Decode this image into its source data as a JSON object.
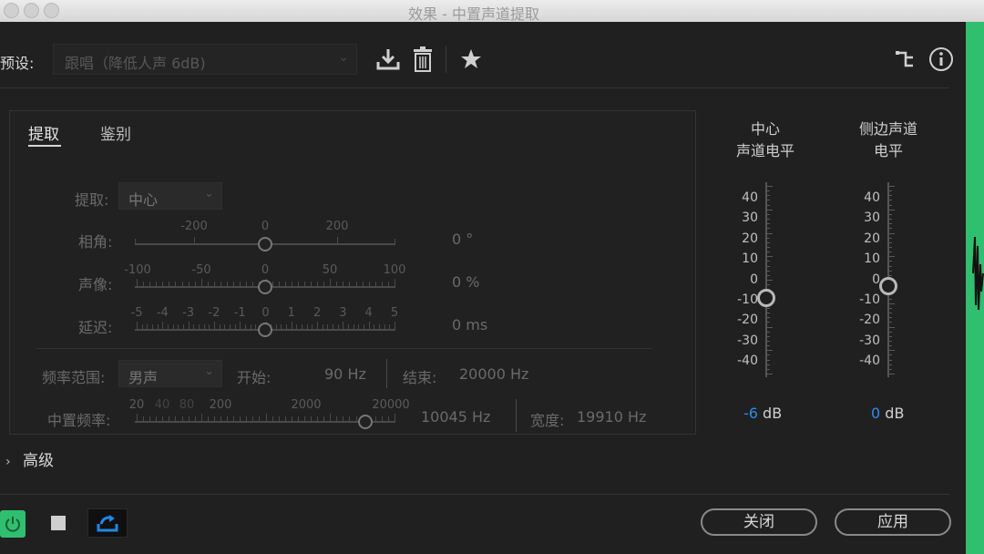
{
  "window": {
    "title": "效果 - 中置声道提取"
  },
  "header": {
    "preset_label": "预设:",
    "preset_value": "跟唱（降低人声 6dB)",
    "icons": [
      "download-icon",
      "trash-icon",
      "star-icon",
      "routing-icon",
      "info-icon"
    ]
  },
  "tabs": [
    {
      "label": "提取",
      "active": true
    },
    {
      "label": "鉴别",
      "active": false
    }
  ],
  "controls": {
    "extract": {
      "label": "提取:",
      "value": "中心"
    },
    "phase": {
      "label": "相角:",
      "value": "0 °",
      "ticks": [
        "-200",
        "0",
        "200"
      ]
    },
    "pan": {
      "label": "声像:",
      "value": "0 %",
      "ticks": [
        "-100",
        "-50",
        "0",
        "50",
        "100"
      ]
    },
    "delay": {
      "label": "延迟:",
      "value": "0 ms",
      "ticks": [
        "-5",
        "-4",
        "-3",
        "-2",
        "-1",
        "0",
        "1",
        "2",
        "3",
        "4",
        "5"
      ]
    },
    "freq_range": {
      "label": "频率范围:",
      "value": "男声",
      "start_label": "开始:",
      "start_value": "90 Hz",
      "end_label": "结束:",
      "end_value": "20000 Hz"
    },
    "center_freq": {
      "label": "中置频率:",
      "value": "10045 Hz",
      "width_label": "宽度:",
      "width_value": "19910 Hz",
      "ticks": [
        "20",
        "40",
        "80",
        "200",
        "2000",
        "20000"
      ]
    }
  },
  "meters": [
    {
      "title_line1": "中心",
      "title_line2": "声道电平",
      "value": "-6",
      "unit": "dB",
      "level_db": -6
    },
    {
      "title_line1": "侧边声道",
      "title_line2": "电平",
      "value": "0",
      "unit": "dB",
      "level_db": 0
    }
  ],
  "meter_scale": [
    "40",
    "30",
    "20",
    "10",
    "0",
    "-10",
    "-20",
    "-30",
    "-40"
  ],
  "advanced_label": "高级",
  "footer": {
    "close_label": "关闭",
    "apply_label": "应用"
  },
  "colors": {
    "accent": "#2d8ceb",
    "power_green": "#2fbf6f",
    "loop_blue": "#1e88e5"
  }
}
